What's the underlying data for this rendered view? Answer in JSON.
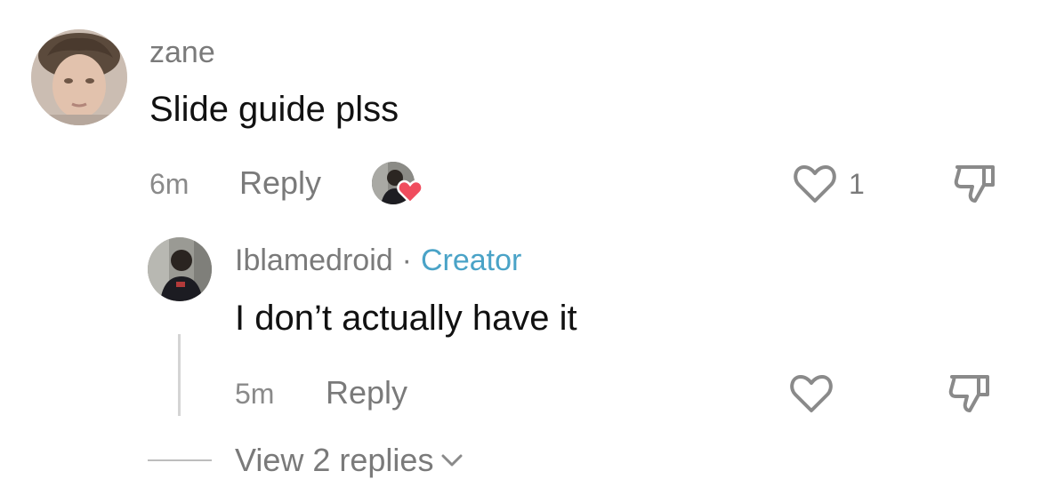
{
  "comment": {
    "username": "zane",
    "text": "Slide guide plss",
    "time": "6m",
    "reply_label": "Reply",
    "like_count": "1",
    "icons": {
      "avatar": "user-avatar",
      "creator_like": "creator-liked-avatar-heart-icon",
      "like": "heart-outline-icon",
      "dislike": "thumbs-down-icon"
    }
  },
  "reply": {
    "username": "Iblamedroid",
    "separator": "·",
    "badge": "Creator",
    "text": "I don’t actually have it",
    "time": "5m",
    "reply_label": "Reply",
    "icons": {
      "avatar": "creator-avatar",
      "like": "heart-outline-icon",
      "dislike": "thumbs-down-icon"
    }
  },
  "view_replies": {
    "label": "View 2 replies",
    "icon": "chevron-down-icon"
  },
  "colors": {
    "creator_badge": "#4aa3c7",
    "liked_heart": "#f04d5e",
    "muted_text": "#7a7a7a",
    "icon_stroke": "#8a8a8a"
  }
}
